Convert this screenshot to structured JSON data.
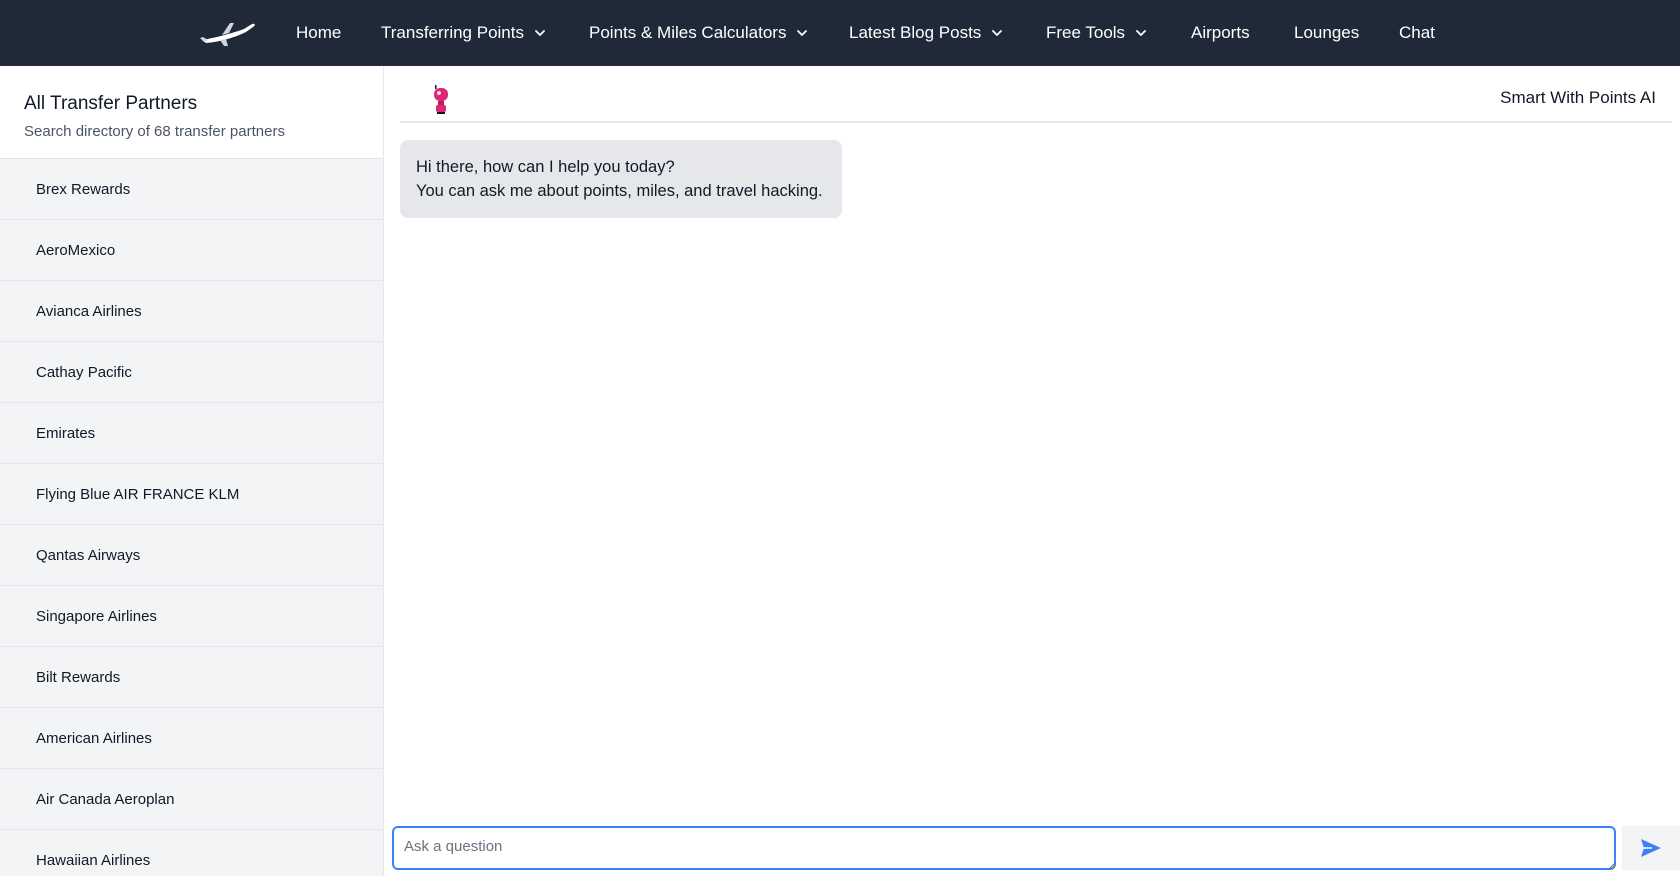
{
  "nav": {
    "items": [
      {
        "label": "Home",
        "dropdown": false
      },
      {
        "label": "Transferring Points",
        "dropdown": true
      },
      {
        "label": "Points & Miles Calculators",
        "dropdown": true
      },
      {
        "label": "Latest Blog Posts",
        "dropdown": true
      },
      {
        "label": "Free Tools",
        "dropdown": true
      },
      {
        "label": "Airports",
        "dropdown": false
      },
      {
        "label": "Lounges",
        "dropdown": false
      },
      {
        "label": "Chat",
        "dropdown": false
      }
    ]
  },
  "sidebar": {
    "title": "All Transfer Partners",
    "subtitle": "Search directory of 68 transfer partners",
    "partners": [
      "Brex Rewards",
      "AeroMexico",
      "Avianca Airlines",
      "Cathay Pacific",
      "Emirates",
      "Flying Blue AIR FRANCE KLM",
      "Qantas Airways",
      "Singapore Airlines",
      "Bilt Rewards",
      "American Airlines",
      "Air Canada Aeroplan",
      "Hawaiian Airlines"
    ]
  },
  "chat": {
    "title": "Smart With Points AI",
    "greeting_line1": "Hi there, how can I help you today?",
    "greeting_line2": "You can ask me about points, miles, and travel hacking.",
    "input_placeholder": "Ask a question",
    "input_value": ""
  },
  "icons": {
    "logo": "airplane-icon",
    "avatar": "robot-avatar-icon",
    "send": "send-icon",
    "chevron": "chevron-down-icon"
  },
  "colors": {
    "nav_bg": "#1f2937",
    "accent": "#3b82f6",
    "bubble_bg": "#e5e7eb",
    "avatar": "#db2777"
  }
}
